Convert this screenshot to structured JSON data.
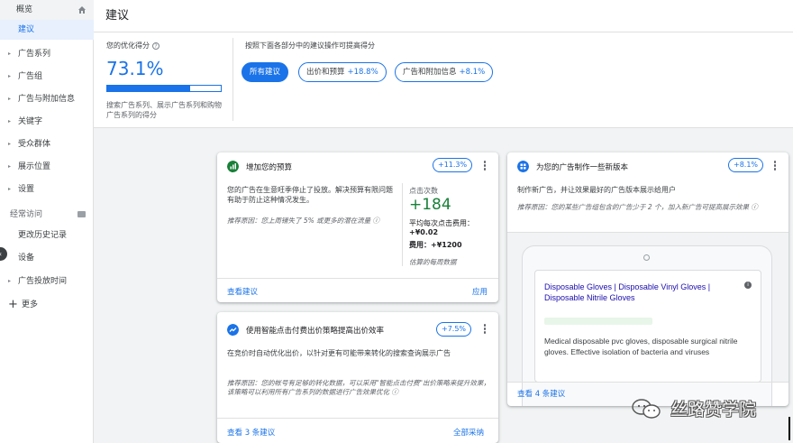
{
  "sidebar": {
    "items": [
      {
        "label": "概览",
        "type": "top"
      },
      {
        "label": "建议",
        "type": "active"
      },
      {
        "label": "广告系列",
        "type": "expandable"
      },
      {
        "label": "广告组",
        "type": "expandable"
      },
      {
        "label": "广告与附加信息",
        "type": "expandable"
      },
      {
        "label": "关键字",
        "type": "expandable"
      },
      {
        "label": "受众群体",
        "type": "expandable"
      },
      {
        "label": "展示位置",
        "type": "expandable"
      },
      {
        "label": "设置",
        "type": "expandable"
      },
      {
        "label": "经常访问",
        "type": "section"
      },
      {
        "label": "更改历史记录",
        "type": "plain"
      },
      {
        "label": "设备",
        "type": "plain"
      },
      {
        "label": "广告投放时间",
        "type": "expandable"
      },
      {
        "label": "更多",
        "type": "more"
      }
    ]
  },
  "header": {
    "title": "建议"
  },
  "score": {
    "label": "您的优化得分",
    "value": "73.1%",
    "progress": 0.731,
    "description": "搜索广告系列、展示广告系列和购物广告系列的得分"
  },
  "filters": {
    "title": "按照下面各部分中的建议操作可提高得分",
    "chips": [
      {
        "label": "所有建议",
        "pct": "",
        "selected": true
      },
      {
        "label": "出价和预算",
        "pct": "+18.8%",
        "selected": false
      },
      {
        "label": "广告和附加信息",
        "pct": "+8.1%",
        "selected": false
      }
    ]
  },
  "cards": {
    "budget": {
      "title": "增加您的预算",
      "badge": "+11.3%",
      "text": "您的广告在生意旺季停止了投放。解决预算有限问题有助于防止这种情况发生。",
      "reason": "推荐原因：您上周错失了 5% 或更多的潜在流量 ⓘ",
      "metric_label": "点击次数",
      "metric_value": "+184",
      "avg_cpc": "平均每次点击费用：",
      "avg_cpc_value": "+¥0.02",
      "cost": "费用：+¥1200",
      "note": "估算的每周数据",
      "link_view": "查看建议",
      "link_apply": "应用",
      "icon_color": "#188038"
    },
    "bidding": {
      "title": "使用智能点击付费出价策略提高出价效率",
      "badge": "+7.5%",
      "text": "在竞价时自动优化出价，以针对更有可能带来转化的搜索查询展示广告",
      "reason": "推荐原因：您的帐号有足够的转化数据，可以采用\"智能点击付费\"出价策略来提升效果，该策略可以利用所有广告系列的数据进行广告效果优化 ⓘ",
      "link_view": "查看 3 条建议",
      "link_apply": "全部采纳",
      "icon_color": "#1a73e8"
    },
    "ads": {
      "title": "为您的广告制作一些新版本",
      "badge": "+8.1%",
      "text": "制作新广告，并让效果最好的广告版本展示给用户",
      "reason": "推荐原因：您的某些广告组包含的广告少于 2 个，加入新广告可提高展示效果 ⓘ",
      "ad_headline": "Disposable Gloves | Disposable Vinyl Gloves | Disposable Nitrile Gloves",
      "ad_description": "Medical disposable pvc gloves, disposable surgical nitrile gloves. Effective isolation of bacteria and viruses",
      "link_view": "查看 4 条建议",
      "icon_color": "#1a73e8"
    }
  },
  "watermark": {
    "text": "丝路赞学院"
  },
  "colors": {
    "accent": "#1a73e8",
    "positive": "#188038"
  }
}
